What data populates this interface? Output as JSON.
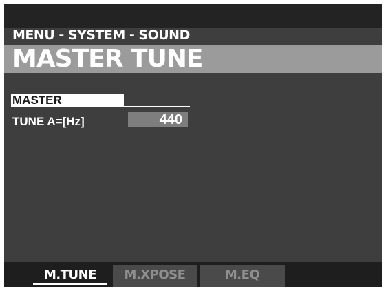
{
  "breadcrumb": "MENU - SYSTEM - SOUND",
  "title": "MASTER TUNE",
  "section": {
    "header": "MASTER"
  },
  "params": [
    {
      "label": "TUNE A=[Hz]",
      "value": "440"
    }
  ],
  "tabs": [
    {
      "label": "M.TUNE",
      "active": true
    },
    {
      "label": "M.XPOSE",
      "active": false
    },
    {
      "label": "M.EQ",
      "active": false
    }
  ],
  "colors": {
    "screen_bg": "#3e3e3e",
    "title_bar": "#9b9b9b",
    "tab_bar": "#1e1e1e",
    "inactive_tab": "#4a4a4a"
  }
}
